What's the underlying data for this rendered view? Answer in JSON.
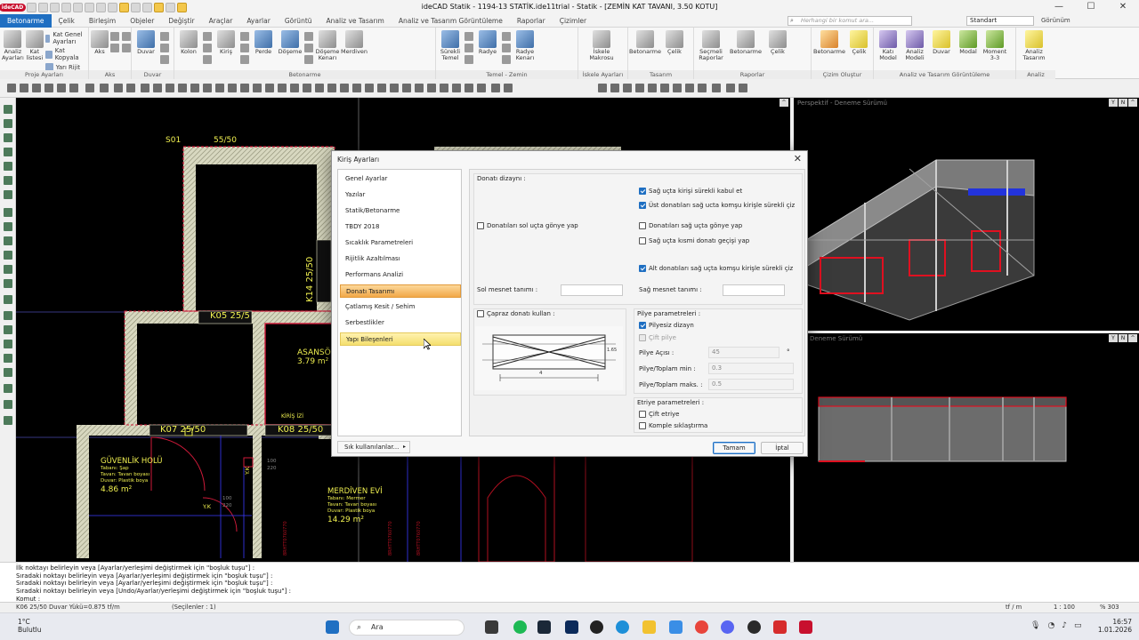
{
  "window": {
    "title": "ideCAD Statik - 1194-13 STATİK.ide11trial - Statik - [ZEMİN KAT TAVANI,  3.50 KOTU]",
    "logo": "ideCAD",
    "controls": [
      "—",
      "☐",
      "✕"
    ]
  },
  "menu": {
    "tabs": [
      "Betonarme",
      "Çelik",
      "Birleşim",
      "Objeler",
      "Değiştir",
      "Araçlar",
      "Ayarlar",
      "Görüntü",
      "Analiz ve Tasarım",
      "Analiz ve Tasarım Görüntüleme",
      "Raporlar",
      "Çizimler"
    ],
    "active_tab": "Betonarme",
    "search_placeholder": "Herhangi bir komut ara...",
    "style_select": "Standart",
    "view_label": "Görünüm"
  },
  "ribbon": {
    "groups": [
      {
        "label": "Proje Ayarları",
        "buttons": [
          {
            "label": "Analiz Ayarları",
            "icon": "gear-icon"
          },
          {
            "label": "Kat listesi",
            "icon": "floor-list-icon"
          }
        ],
        "small": [
          "Kat Genel Ayarları",
          "Kat Kopyala",
          "Yarı Rijit"
        ]
      },
      {
        "label": "Aks",
        "buttons": [
          {
            "label": "Aks",
            "icon": "axis-icon"
          }
        ]
      },
      {
        "label": "Duvar",
        "buttons": [
          {
            "label": "Duvar",
            "icon": "wall-icon"
          }
        ]
      },
      {
        "label": "Betonarme",
        "buttons": [
          {
            "label": "Kolon",
            "icon": "column-icon"
          },
          {
            "label": "Kiriş",
            "icon": "beam-icon"
          },
          {
            "label": "Perde",
            "icon": "shear-wall-icon"
          },
          {
            "label": "Döşeme",
            "icon": "slab-icon"
          },
          {
            "label": "Döşeme Kenarı",
            "icon": "slab-edge-icon"
          },
          {
            "label": "Merdiven",
            "icon": "stair-icon"
          }
        ]
      },
      {
        "label": "Temel - Zemin",
        "buttons": [
          {
            "label": "Sürekli Temel",
            "icon": "strip-footing-icon"
          },
          {
            "label": "Radye",
            "icon": "raft-icon"
          },
          {
            "label": "Radye Kenarı",
            "icon": "raft-edge-icon"
          }
        ]
      },
      {
        "label": "İskele Ayarları",
        "buttons": [
          {
            "label": "İskele Makrosu",
            "icon": "scaffold-icon"
          }
        ]
      },
      {
        "label": "Tasarım",
        "buttons": [
          {
            "label": "Betonarme",
            "icon": "rc-design-icon"
          },
          {
            "label": "Çelik",
            "icon": "steel-design-icon"
          }
        ]
      },
      {
        "label": "Raporlar",
        "buttons": [
          {
            "label": "Seçmeli Raporlar",
            "icon": "report-icon"
          },
          {
            "label": "Betonarme",
            "icon": "rc-report-icon"
          },
          {
            "label": "Çelik",
            "icon": "steel-report-icon"
          }
        ]
      },
      {
        "label": "Çizim Oluştur",
        "buttons": [
          {
            "label": "Betonarme",
            "icon": "rc-drawing-icon"
          },
          {
            "label": "Çelik",
            "icon": "steel-drawing-icon"
          }
        ]
      },
      {
        "label": "Analiz ve Tasarım Görüntüleme",
        "buttons": [
          {
            "label": "Katı Model",
            "icon": "solid-model-icon"
          },
          {
            "label": "Analiz Modeli",
            "icon": "analysis-model-icon"
          },
          {
            "label": "Duvar",
            "icon": "wall-view-icon"
          },
          {
            "label": "Modal",
            "icon": "modal-icon"
          },
          {
            "label": "Moment 3-3",
            "icon": "moment-icon"
          }
        ]
      },
      {
        "label": "Analiz",
        "buttons": [
          {
            "label": "Analiz Tasarım",
            "icon": "lightning-icon"
          }
        ]
      }
    ]
  },
  "viewports": {
    "main": {
      "labels": {
        "s01": "S01",
        "s01_dim": "55/50",
        "k14": "K14 25/50",
        "k05": "K05 25/5",
        "k07": "K07 25/50",
        "k08": "K08 25/50",
        "kiris_izi": "KİRİŞ İZİ",
        "asansor": "ASANSÖR",
        "asansor_area": "3.79 m²",
        "guvenlik": "GÜVENLİK HOLÜ",
        "guvenlik_l1": "Tabanı: Şap",
        "guvenlik_l2": "Tavan: Tavan boyası",
        "guvenlik_l3": "Duvar: Plastik boya",
        "guvenlik_area": "4.86 m²",
        "merdiven": "MERDİVEN EVİ",
        "merdiven_l1": "Tabanı: Mermer",
        "merdiven_l2": "Tavan: Tavan boyası",
        "merdiven_l3": "Duvar: Plastik boya",
        "merdiven_area": "14.29 m²",
        "yk1": "Y.K",
        "yk2": "Y.K",
        "dim_100a": "100",
        "dim_220a": "220",
        "dim_100b": "100",
        "dim_220b": "220",
        "vert1": "8RHTT0760770",
        "vert2": "8RHTT0760770",
        "vert3": "8RHTT0760770"
      }
    },
    "perspective": {
      "label": "Perspektif - Deneme Sürümü"
    },
    "elevation": {
      "label": "Deneme Sürümü"
    }
  },
  "dialog": {
    "title": "Kiriş Ayarları",
    "close": "✕",
    "nav": [
      {
        "label": "Genel Ayarlar",
        "state": "normal"
      },
      {
        "label": "Yazılar",
        "state": "normal"
      },
      {
        "label": "Statik/Betonarme",
        "state": "normal"
      },
      {
        "label": "TBDY 2018",
        "state": "normal"
      },
      {
        "label": "Sıcaklık Parametreleri",
        "state": "normal"
      },
      {
        "label": "Rijitlik Azaltılması",
        "state": "normal"
      },
      {
        "label": "Performans Analizi",
        "state": "normal"
      },
      {
        "label": "Donatı Tasarımı",
        "state": "active"
      },
      {
        "label": "Çatlamış Kesit / Sehim",
        "state": "normal"
      },
      {
        "label": "Serbestlikler",
        "state": "normal"
      },
      {
        "label": "Yapı Bileşenleri",
        "state": "hover"
      }
    ],
    "favorites_button": "Sık kullanılanlar...",
    "panel": {
      "group_title": "Donatı dizaynı :",
      "checkboxes": {
        "sag_sureki": {
          "label": "Sağ uçta kirişi sürekli kabul et",
          "checked": true
        },
        "ust_donati": {
          "label": "Üst donatıları sağ ucta komşu kirişle sürekli çiz",
          "checked": true
        },
        "sol_gonye": {
          "label": "Donatıları sol uçta gönye yap",
          "checked": false
        },
        "sag_gonye": {
          "label": "Donatıları sağ uçta gönye yap",
          "checked": false
        },
        "kismi_gecis": {
          "label": "Sağ uçta kısmi donatı geçişi yap",
          "checked": false
        },
        "alt_donati": {
          "label": "Alt donatıları sağ uçta komşu kirişle sürekli çiz",
          "checked": true
        },
        "capraz": {
          "label": "Çapraz donatı kullan :",
          "checked": false
        },
        "pilyesiz": {
          "label": "Pilyesiz dizayn",
          "checked": true
        },
        "cift_pilye": {
          "label": "Çift pilye",
          "checked": false
        },
        "cift_etriye": {
          "label": "Çift etriye",
          "checked": false
        },
        "komple": {
          "label": "Komple sıklaştırma",
          "checked": false
        }
      },
      "sol_mesnet": "Sol mesnet tanımı :",
      "sag_mesnet": "Sağ mesnet tanımı :",
      "pilye_title": "Pilye parametreleri :",
      "pilye_acisi_label": "Pilye Açısı :",
      "pilye_acisi_value": "45",
      "pilye_acisi_unit": "°",
      "pilye_min_label": "Pilye/Toplam min :",
      "pilye_min_value": "0.3",
      "pilye_max_label": "Pilye/Toplam maks. :",
      "pilye_max_value": "0.5",
      "etriye_title": "Etriye parametreleri :",
      "diagram_dim1": "4",
      "diagram_dim2": "1.65"
    },
    "ok": "Tamam",
    "cancel": "İptal"
  },
  "command": {
    "lines": [
      "İlk noktayı belirleyin veya [Ayarlar/yerleşimi değiştirmek için \"boşluk tuşu\"] :",
      "Sıradaki noktayı belirleyin veya [Ayarlar/yerleşimi değiştirmek için \"boşluk tuşu\"] :",
      "Sıradaki noktayı belirleyin veya [Ayarlar/yerleşimi değiştirmek için \"boşluk tuşu\"] :",
      "Sıradaki noktayı belirleyin veya [Undo/Ayarlar/yerleşimi değiştirmek için \"boşluk tuşu\"] :",
      "Komut :"
    ]
  },
  "status": {
    "left": "K06 25/50 Duvar Yükü=0.875 tf/m",
    "selected": "(Seçilenler : 1)",
    "units": "tf / m",
    "scale": "1 : 100",
    "zoom": "% 303"
  },
  "taskbar": {
    "temperature": "1°C",
    "weather": "Bulutlu",
    "search": "Ara",
    "time": "16:57",
    "date": "1.01.2026"
  },
  "colors": {
    "accent": "#1f6fc2",
    "cad_background": "#000000",
    "nav_active": "#f2a848",
    "nav_hover": "#f4df6f",
    "wall_hatch": "#e8e8c8",
    "text_yellow": "#f0f050",
    "beam_red": "#e01020"
  }
}
